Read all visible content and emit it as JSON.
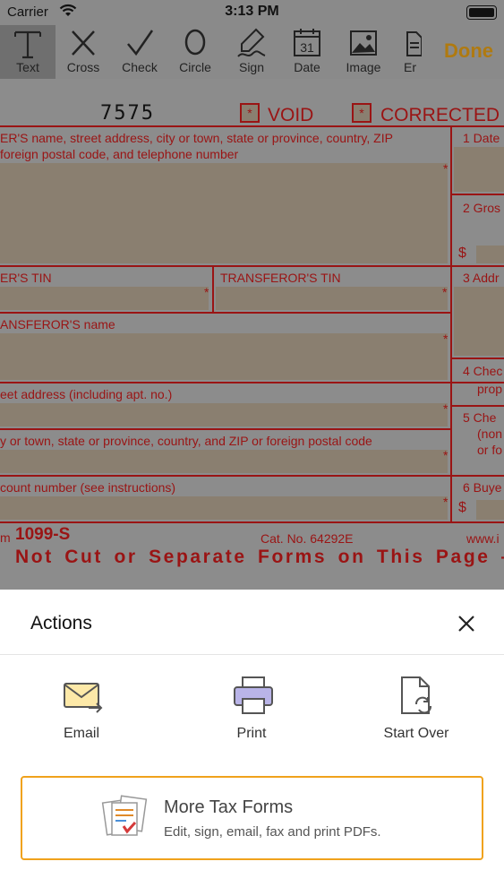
{
  "status_bar": {
    "carrier": "Carrier",
    "time": "3:13 PM"
  },
  "toolbar": {
    "tools": [
      {
        "label": "Text",
        "icon": "text-tool-icon",
        "active": true
      },
      {
        "label": "Cross",
        "icon": "cross-tool-icon"
      },
      {
        "label": "Check",
        "icon": "check-tool-icon"
      },
      {
        "label": "Circle",
        "icon": "circle-tool-icon"
      },
      {
        "label": "Sign",
        "icon": "sign-tool-icon"
      },
      {
        "label": "Date",
        "icon": "date-tool-icon",
        "date_number": "31"
      },
      {
        "label": "Image",
        "icon": "image-tool-icon"
      },
      {
        "label": "Er",
        "icon": "erase-tool-icon"
      }
    ],
    "done_label": "Done",
    "done_color": "#b07a10"
  },
  "form": {
    "number": "7575",
    "void_label": "VOID",
    "corrected_label": "CORRECTED",
    "checkbox_mark": "*",
    "filer_label_1": "ER'S name, street address, city or town, state or province, country, ZIP",
    "filer_label_2": "foreign postal code, and telephone number",
    "box1_label": "1  Date",
    "box2_label": "2  Gros",
    "dollar": "$",
    "filer_tin_label": "ER'S TIN",
    "transferor_tin_label": "TRANSFEROR'S TIN",
    "box3_label": "3  Addr",
    "transferor_name_label": "ANSFEROR'S name",
    "street_label": "eet address (including apt. no.)",
    "box4_label_1": "4  Chec",
    "box4_label_2": "prop",
    "city_label": "y or town, state or province, country, and ZIP or foreign postal code",
    "box5_label_1": "5  Che",
    "box5_label_2": "(non",
    "box5_label_3": "or fo",
    "account_label": "count number (see instructions)",
    "box6_label": "6  Buye",
    "form_prefix": "m",
    "form_name": "1099-S",
    "cat_no": "Cat. No. 64292E",
    "website": "www.i",
    "do_not_cut": "Not Cut or Separate Forms on This Page —",
    "field_star": "*"
  },
  "actions_sheet": {
    "title": "Actions",
    "actions": [
      {
        "label": "Email",
        "icon": "email-icon"
      },
      {
        "label": "Print",
        "icon": "printer-icon"
      },
      {
        "label": "Start Over",
        "icon": "start-over-icon"
      }
    ],
    "promo": {
      "title": "More Tax Forms",
      "subtitle": "Edit, sign, email, fax and print PDFs.",
      "border_color": "#f0a21c"
    }
  }
}
